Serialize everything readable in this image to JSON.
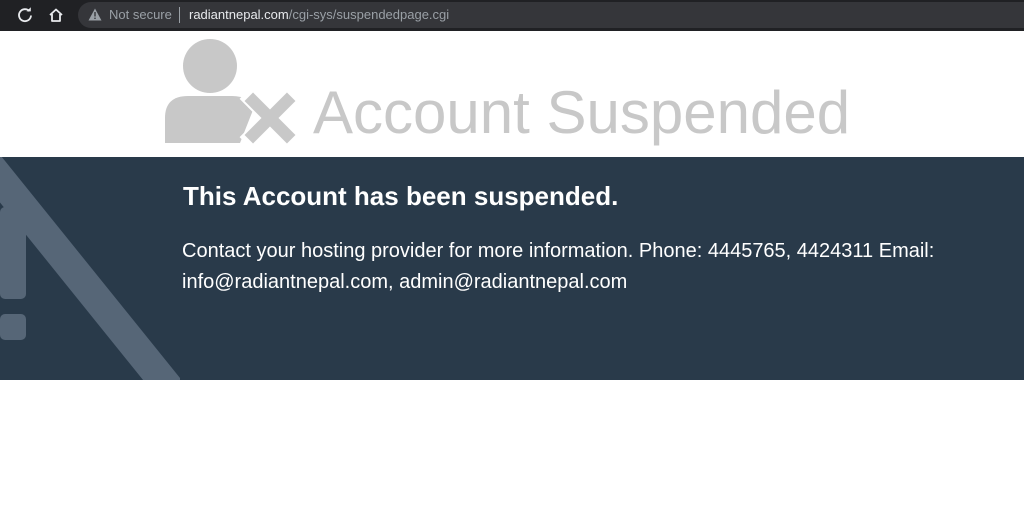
{
  "browser": {
    "security_label": "Not secure",
    "url_host": "radiantnepal.com",
    "url_path": "/cgi-sys/suspendedpage.cgi",
    "icons": [
      "reload-icon",
      "home-icon",
      "warning-triangle-icon"
    ]
  },
  "header": {
    "title": "Account Suspended",
    "icon": "user-x-icon"
  },
  "message": {
    "heading": "This Account has been suspended.",
    "body": "Contact your hosting provider for more information. Phone: 4445765, 4424311 Email: info@radiantnepal.com, admin@radiantnepal.com"
  },
  "colors": {
    "toolbar": "#202124",
    "panel": "#293a4a",
    "headline": "#c8c8c8",
    "heading": "#ffffff"
  }
}
